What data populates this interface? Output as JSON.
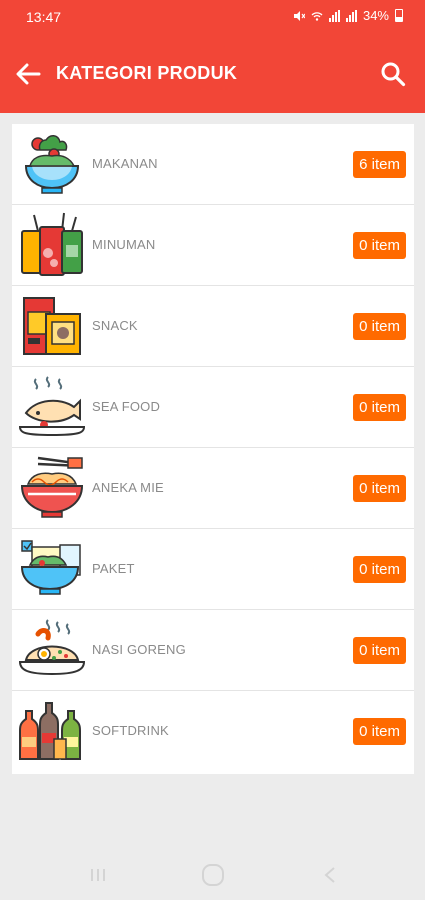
{
  "status_bar": {
    "time": "13:47",
    "battery": "34%"
  },
  "toolbar": {
    "title": "KATEGORI PRODUK"
  },
  "categories": [
    {
      "label": "MAKANAN",
      "count": "6 item"
    },
    {
      "label": "MINUMAN",
      "count": "0 item"
    },
    {
      "label": "SNACK",
      "count": "0 item"
    },
    {
      "label": "SEA FOOD",
      "count": "0 item"
    },
    {
      "label": "ANEKA MIE",
      "count": "0 item"
    },
    {
      "label": "PAKET",
      "count": "0 item"
    },
    {
      "label": "NASI GORENG",
      "count": "0 item"
    },
    {
      "label": "SOFTDRINK",
      "count": "0 item"
    }
  ],
  "colors": {
    "appbar": "#f24637",
    "badge": "#ff6a00",
    "background": "#ececec"
  }
}
